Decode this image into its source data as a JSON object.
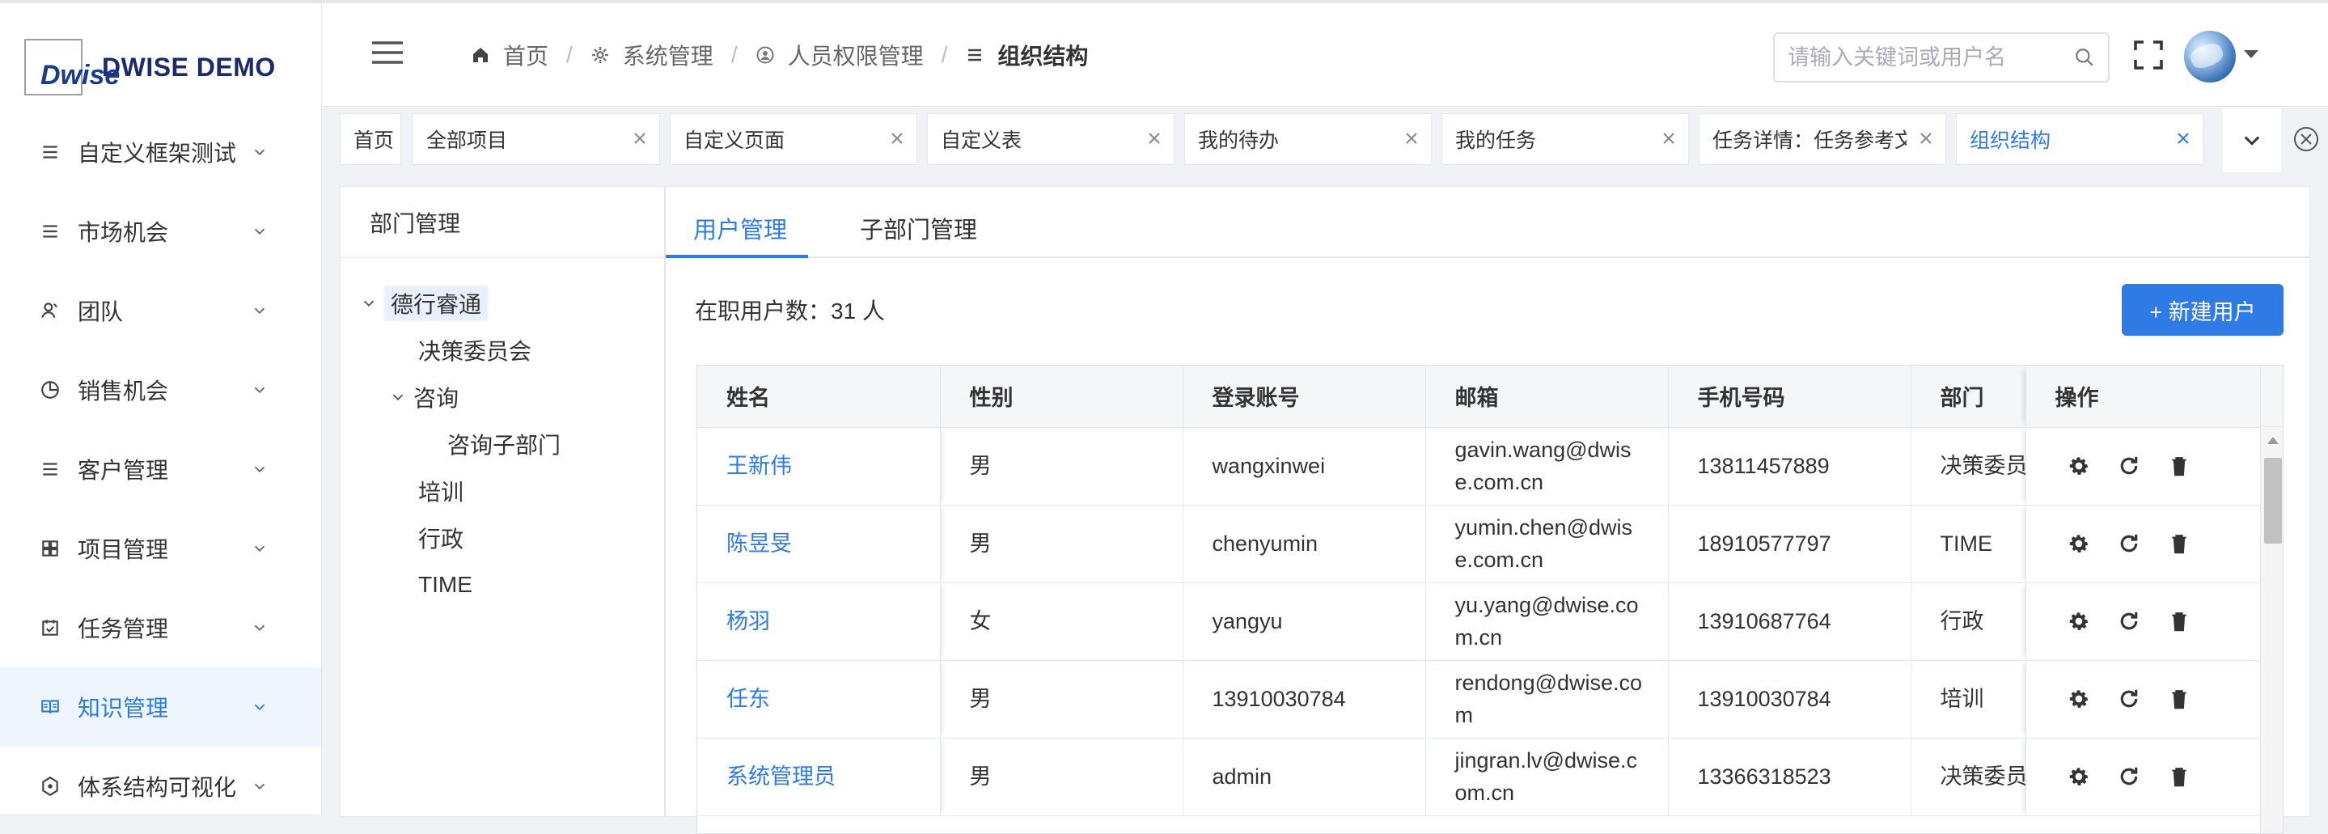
{
  "app": {
    "logo_mark": "Dwise",
    "logo_text": "DWISE DEMO"
  },
  "sidebar": {
    "items": [
      {
        "label": "自定义框架测试",
        "icon": "list-icon"
      },
      {
        "label": "市场机会",
        "icon": "list-icon"
      },
      {
        "label": "团队",
        "icon": "team-icon"
      },
      {
        "label": "销售机会",
        "icon": "pie-chart-icon"
      },
      {
        "label": "客户管理",
        "icon": "list-icon"
      },
      {
        "label": "项目管理",
        "icon": "grid-icon"
      },
      {
        "label": "任务管理",
        "icon": "calendar-check-icon"
      },
      {
        "label": "知识管理",
        "icon": "book-icon",
        "active": true
      },
      {
        "label": "体系结构可视化",
        "icon": "network-icon"
      }
    ]
  },
  "header": {
    "breadcrumb": [
      {
        "label": "首页",
        "icon": "home-icon"
      },
      {
        "label": "系统管理",
        "icon": "gear-icon"
      },
      {
        "label": "人员权限管理",
        "icon": "user-circle-icon"
      },
      {
        "label": "组织结构",
        "icon": "menu-icon"
      }
    ],
    "search": {
      "placeholder": "请输入关键词或用户名",
      "value": ""
    }
  },
  "tabs": [
    {
      "label": "首页",
      "closable": false
    },
    {
      "label": "全部项目",
      "closable": true
    },
    {
      "label": "自定义页面",
      "closable": true
    },
    {
      "label": "自定义表",
      "closable": true
    },
    {
      "label": "我的待办",
      "closable": true
    },
    {
      "label": "我的任务",
      "closable": true
    },
    {
      "label": "任务详情：任务参考文",
      "closable": true
    },
    {
      "label": "组织结构",
      "closable": true,
      "active": true
    }
  ],
  "dept": {
    "title": "部门管理",
    "tree": [
      {
        "label": "德行睿通",
        "level": 0,
        "expanded": true,
        "selected": true
      },
      {
        "label": "决策委员会",
        "level": 1
      },
      {
        "label": "咨询",
        "level": 1,
        "expanded": true
      },
      {
        "label": "咨询子部门",
        "level": 2
      },
      {
        "label": "培训",
        "level": 1
      },
      {
        "label": "行政",
        "level": 1
      },
      {
        "label": "TIME",
        "level": 1
      }
    ]
  },
  "users": {
    "tabs": [
      "用户管理",
      "子部门管理"
    ],
    "count_text": "在职用户数：31 人",
    "new_button": "+ 新建用户",
    "columns": [
      "姓名",
      "性别",
      "登录账号",
      "邮箱",
      "手机号码",
      "部门",
      "操作"
    ],
    "rows": [
      {
        "name": "王新伟",
        "gender": "男",
        "account": "wangxinwei",
        "email": "gavin.wang@dwise.com.cn",
        "phone": "13811457889",
        "dept": "决策委员会"
      },
      {
        "name": "陈昱旻",
        "gender": "男",
        "account": "chenyumin",
        "email": "yumin.chen@dwise.com.cn",
        "phone": "18910577797",
        "dept": "TIME"
      },
      {
        "name": "杨羽",
        "gender": "女",
        "account": "yangyu",
        "email": "yu.yang@dwise.com.cn",
        "phone": "13910687764",
        "dept": "行政"
      },
      {
        "name": "任东",
        "gender": "男",
        "account": "13910030784",
        "email": "rendong@dwise.com",
        "phone": "13910030784",
        "dept": "培训"
      },
      {
        "name": "系统管理员",
        "gender": "男",
        "account": "admin",
        "email": "jingran.lv@dwise.com.cn",
        "phone": "13366318523",
        "dept": "决策委员会"
      }
    ]
  },
  "colors": {
    "accent": "#2f7be6",
    "active_bg": "#eef5fd"
  }
}
